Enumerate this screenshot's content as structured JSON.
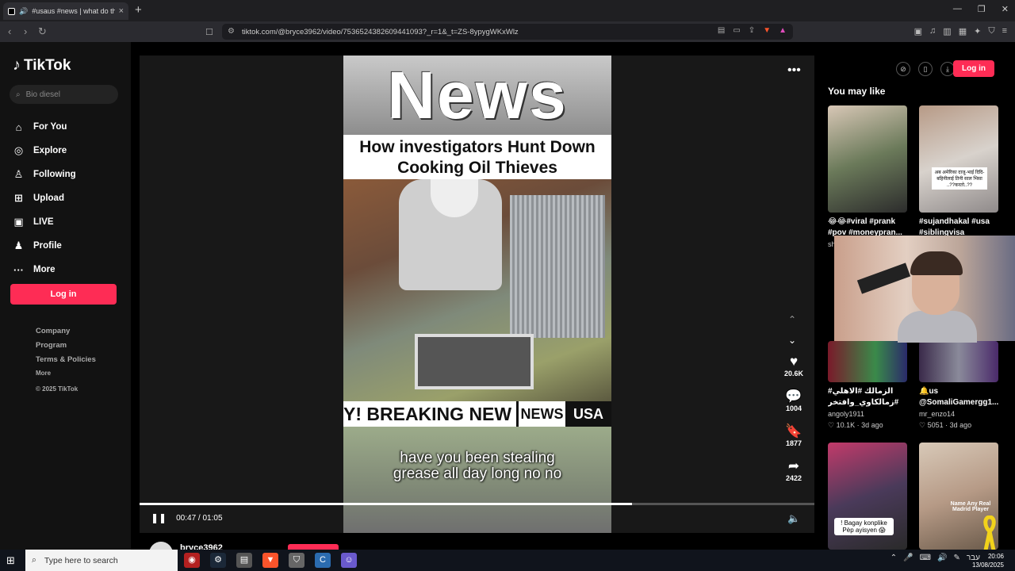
{
  "browser": {
    "tab_title": "#usaus #news | what do they",
    "tab_close": "×",
    "new_tab": "+",
    "url": "tiktok.com/@bryce3962/video/7536524382609441093?_r=1&_t=ZS-8ypygWKxWlz",
    "window_controls": [
      "—",
      "❐",
      "✕"
    ]
  },
  "sidebar": {
    "logo": "TikTok",
    "search_placeholder": "Bio diesel",
    "nav": [
      {
        "label": "For You",
        "icon": "home-icon"
      },
      {
        "label": "Explore",
        "icon": "compass-icon"
      },
      {
        "label": "Following",
        "icon": "user-icon"
      },
      {
        "label": "Upload",
        "icon": "plus-square-icon"
      },
      {
        "label": "LIVE",
        "icon": "live-icon"
      },
      {
        "label": "Profile",
        "icon": "person-icon"
      },
      {
        "label": "More",
        "icon": "dots-icon"
      }
    ],
    "login_label": "Log in",
    "footer_links": [
      "Company",
      "Program",
      "Terms & Policies"
    ],
    "footer_more": "More",
    "copyright": "© 2025 TikTok"
  },
  "video": {
    "big_word": "News",
    "headline_1": "How investigators Hunt Down",
    "headline_2": "Cooking Oil Thieves",
    "breaking": "Y! BREAKING NEW",
    "news_tag": "NEWS",
    "usa_tag": "USA",
    "caption_1": "have you been stealing",
    "caption_2": "grease all day long no no",
    "current_time": "00:47",
    "duration": "01:05",
    "time_sep": "/",
    "progress_fraction": 0.73,
    "author": "bryce3962"
  },
  "actions": {
    "likes": "20.6K",
    "comments": "1004",
    "saves": "1877",
    "shares": "2422"
  },
  "right_panel": {
    "login_label": "Log in",
    "title": "You may like",
    "cards": [
      {
        "desc": "😂😂#viral #prank #pov #moneypran...",
        "user": "sh",
        "likes": "",
        "age": ""
      },
      {
        "desc": "#sujandhakal #usa #siblingvisa",
        "user": "",
        "likes": "",
        "age": ""
      },
      {
        "desc": "#الزمالك #الاهلي #زمالكاوي_وافتخر",
        "user": "angoly1911",
        "likes": "10.1K",
        "age": "3d ago"
      },
      {
        "desc": "🔔us @SomaliGamergg1...",
        "user": "mr_enzo14",
        "likes": "5051",
        "age": "3d ago"
      },
      {
        "desc": "",
        "user": "",
        "likes": "",
        "age": ""
      },
      {
        "desc": "",
        "user": "",
        "likes": "",
        "age": ""
      }
    ],
    "thumb_overlay_2": "अब अमेरिका दाजु-भाई दिदि-बहिनीलाई तिनी साल भिसा ..??करतो..??",
    "badge_bagay": "! Bagay konplike Pèp ayisyen 😱",
    "badge_name": "Name Any Real Madrid Player"
  },
  "taskbar": {
    "search_placeholder": "Type here to search",
    "lang": "עבר",
    "time": "20:06",
    "date": "13/08/2025"
  },
  "colors": {
    "accent": "#fe2c55",
    "background": "#000000",
    "sidebar": "#121212"
  }
}
